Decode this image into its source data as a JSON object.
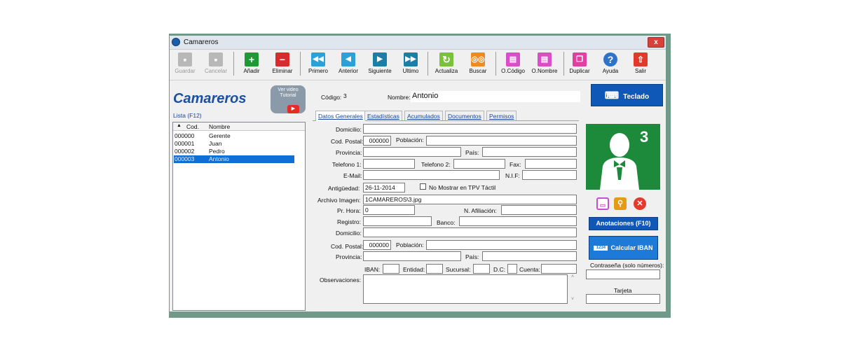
{
  "window": {
    "title": "Camareros",
    "close": "x"
  },
  "toolbar": {
    "guardar": "Guardar",
    "cancelar": "Cancelar",
    "anadir": "Añadir",
    "eliminar": "Eliminar",
    "primero": "Primero",
    "anterior": "Anterior",
    "siguiente": "Siguiente",
    "ultimo": "Ultimo",
    "actualizar": "Actualiza",
    "buscar": "Buscar",
    "ocodigo": "O.Código",
    "onombre": "O.Nombre",
    "duplicar": "Duplicar",
    "ayuda": "Ayuda",
    "salir": "Salir"
  },
  "header": {
    "title": "Camareros",
    "video_line1": "Ver video",
    "video_line2": "Tutorial",
    "codigo_label": "Código:",
    "codigo_value": "3",
    "nombre_label": "Nombre:",
    "nombre_value": "Antonio",
    "teclado": "Teclado"
  },
  "list": {
    "label": "Lista (F12)",
    "columns": [
      "Cod.",
      "Nombre"
    ],
    "rows": [
      {
        "cod": "000000",
        "nombre": "Gerente"
      },
      {
        "cod": "000001",
        "nombre": "Juan"
      },
      {
        "cod": "000002",
        "nombre": "Pedro"
      },
      {
        "cod": "000003",
        "nombre": "Antonio"
      }
    ]
  },
  "tabs": [
    "Datos Generales",
    "Estadísticas",
    "Acumulados",
    "Documentos",
    "Permisos"
  ],
  "form": {
    "domicilio": "Domicilio:",
    "cod_postal": "Cod. Postal:",
    "cod_postal_value": "000000",
    "poblacion": "Población:",
    "provincia": "Provincia:",
    "pais": "País:",
    "telefono1": "Telefono 1:",
    "telefono2": "Telefono 2:",
    "fax": "Fax:",
    "email": "E-Mail:",
    "nif": "N.I.F:",
    "antiguedad": "Antigüedad:",
    "antiguedad_value": "26-11-2014",
    "no_mostrar": "No Mostrar en TPV Táctil",
    "archivo_imagen": "Archivo Imagen:",
    "archivo_value": "1CAMAREROS\\3.jpg",
    "pr_hora": "Pr. Hora:",
    "pr_hora_value": "0",
    "n_afiliacion": "N. Afiliación:",
    "registro": "Registro:",
    "banco": "Banco:",
    "domicilio2": "Domicilio:",
    "cod_postal2": "Cod. Postal:",
    "cod_postal2_value": "000000",
    "poblacion2": "Población:",
    "provincia2": "Provincia:",
    "pais2": "País:",
    "iban": "IBAN:",
    "entidad": "Entidad:",
    "sucursal": "Sucursal:",
    "dc": "D.C:",
    "cuenta": "Cuenta:",
    "observaciones": "Observaciones:"
  },
  "side": {
    "photo_number": "3",
    "anotaciones": "Anotaciones (F10)",
    "calcular_iban": "Calcular IBAN",
    "calc_icon": "1234",
    "contrasena": "Contraseña (solo números):",
    "tarjeta": "Tarjeta"
  }
}
